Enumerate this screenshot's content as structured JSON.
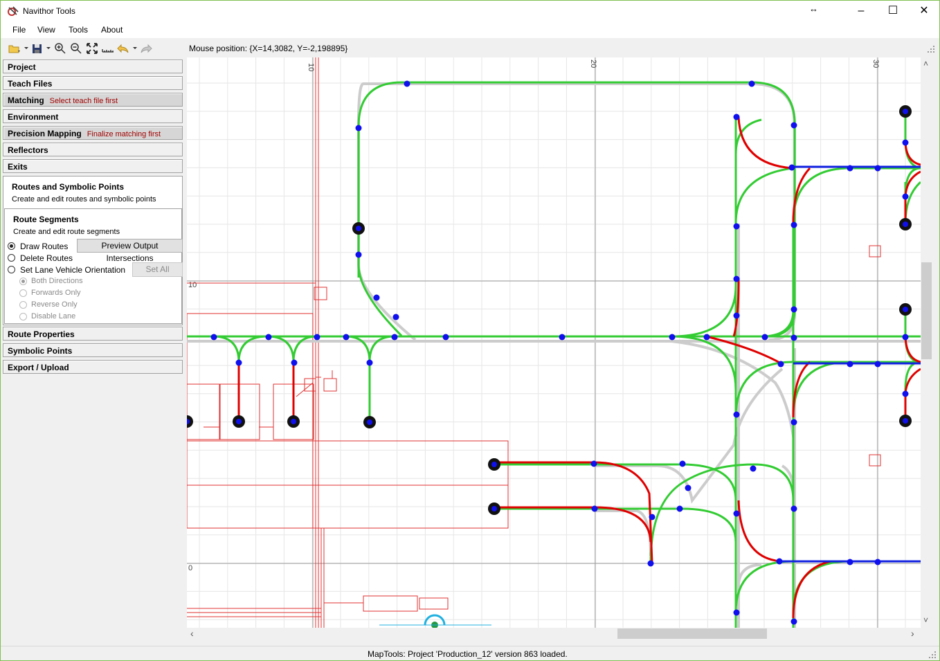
{
  "window": {
    "title": "Navithor Tools",
    "resize_glyph": "↔",
    "minimize": "–",
    "maximize": "☐",
    "close": "✕"
  },
  "menu": [
    "File",
    "View",
    "Tools",
    "About"
  ],
  "toolbar": {
    "icons": [
      "open-folder-icon",
      "save-icon",
      "zoom-in-icon",
      "zoom-out-icon",
      "fit-to-screen-icon",
      "measure-ruler-icon",
      "undo-icon",
      "redo-icon"
    ]
  },
  "mouse_position": "Mouse position: {X=14,3082, Y=-2,198895}",
  "panel": {
    "project": "Project",
    "teach_files": "Teach Files",
    "matching": {
      "label": "Matching",
      "note": "Select teach file first"
    },
    "environment": "Environment",
    "precision_mapping": {
      "label": "Precision Mapping",
      "note": "Finalize matching first"
    },
    "reflectors": "Reflectors",
    "exits": "Exits",
    "routes_group": {
      "title": "Routes and Symbolic Points",
      "subtitle": "Create and edit routes and symbolic points"
    },
    "segments_group": {
      "title": "Route Segments",
      "subtitle": "Create and edit route segments",
      "draw_routes": "Draw Routes",
      "delete_routes": "Delete Routes",
      "set_lane_orientation": "Set Lane Vehicle Orientation",
      "preview_button": "Preview Output Intersections",
      "set_all_button": "Set All",
      "directions": [
        "Both Directions",
        "Forwards Only",
        "Reverse Only",
        "Disable Lane"
      ]
    },
    "route_properties": "Route Properties",
    "symbolic_points": "Symbolic Points",
    "export_upload": "Export / Upload"
  },
  "map": {
    "axis_labels": {
      "x10": "10",
      "x20": "20",
      "x30": "30",
      "y10": "10",
      "y0": "0"
    },
    "colors": {
      "route": "#33cc33",
      "route_selected": "#e00000",
      "route_blue": "#1020e0",
      "node": "#1010ee",
      "ghost": "#cccccc",
      "environment": "#e03030",
      "grid": "#e6e6e6",
      "axis": "#9a9a9a"
    }
  },
  "scroll": {
    "up": "˄",
    "down": "˅",
    "left": "‹",
    "right": "›"
  },
  "status": "MapTools: Project 'Production_12' version 863 loaded."
}
